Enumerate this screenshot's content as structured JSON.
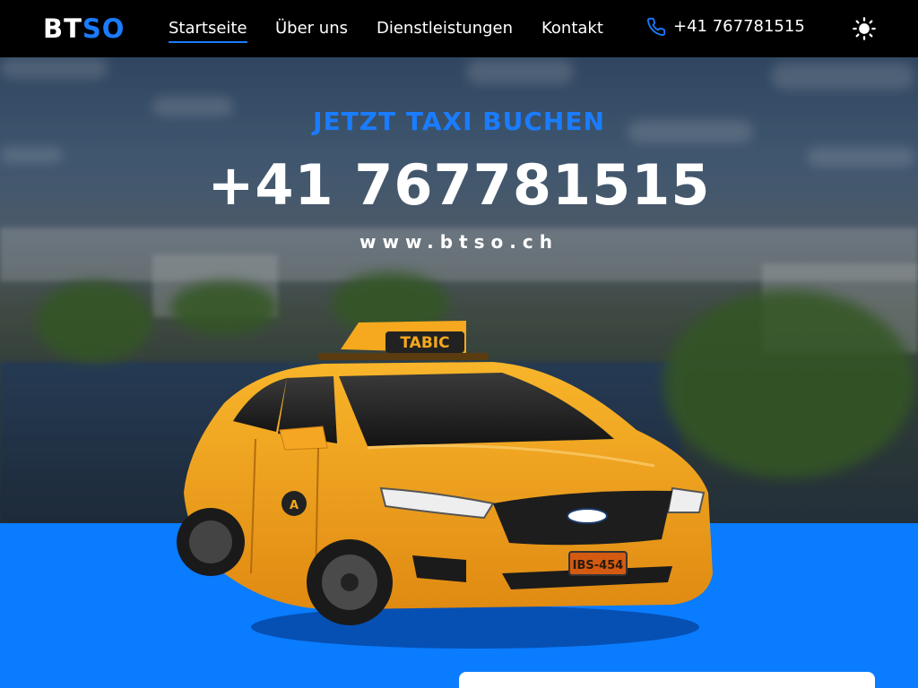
{
  "nav": {
    "logo_part1": "BT",
    "logo_part2": "SO",
    "links": [
      {
        "label": "Startseite"
      },
      {
        "label": "Über uns"
      },
      {
        "label": "Dienstleistungen"
      },
      {
        "label": "Kontakt"
      }
    ],
    "active": "Startseite",
    "phone": "+41 767781515",
    "icons": {
      "phone": "phone-icon",
      "theme": "sun-icon"
    }
  },
  "hero": {
    "tagline": "JETZT TAXI BUCHEN",
    "phone": "+41 767781515",
    "website": "www.btso.ch",
    "taxi_sign": "TABIC",
    "plate": "IBS-454"
  },
  "colors": {
    "accent": "#1a7cff",
    "navbar": "#000000",
    "band": "#0a7cff",
    "taxi": "#f4a21a"
  }
}
